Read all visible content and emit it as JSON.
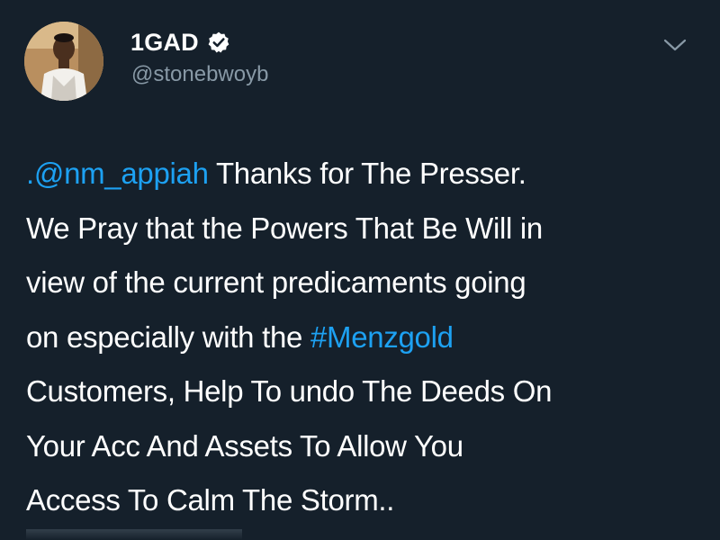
{
  "author": {
    "display_name": "1GAD",
    "handle": "@stonebwoyb",
    "verified": true
  },
  "icons": {
    "verified": "verified-badge-icon",
    "menu": "chevron-down-icon"
  },
  "tweet": {
    "lines": [
      [
        {
          "text": ".@nm_appiah",
          "type": "mention"
        },
        {
          "text": " Thanks for The Presser.",
          "type": "text"
        }
      ],
      [
        {
          "text": "We Pray that the Powers That Be Will in",
          "type": "text"
        }
      ],
      [
        {
          "text": "view of the current predicaments going",
          "type": "text"
        }
      ],
      [
        {
          "text": "on especially with the ",
          "type": "text"
        },
        {
          "text": "#Menzgold",
          "type": "hashtag"
        }
      ],
      [
        {
          "text": "Customers, Help To undo The Deeds On",
          "type": "text"
        }
      ],
      [
        {
          "text": "Your Acc And Assets To Allow You",
          "type": "text"
        }
      ],
      [
        {
          "text": "Access To Calm The Storm..",
          "type": "text"
        }
      ]
    ]
  },
  "colors": {
    "background": "#15202b",
    "text": "#ffffff",
    "secondary": "#8899a6",
    "link": "#1da1f2"
  }
}
